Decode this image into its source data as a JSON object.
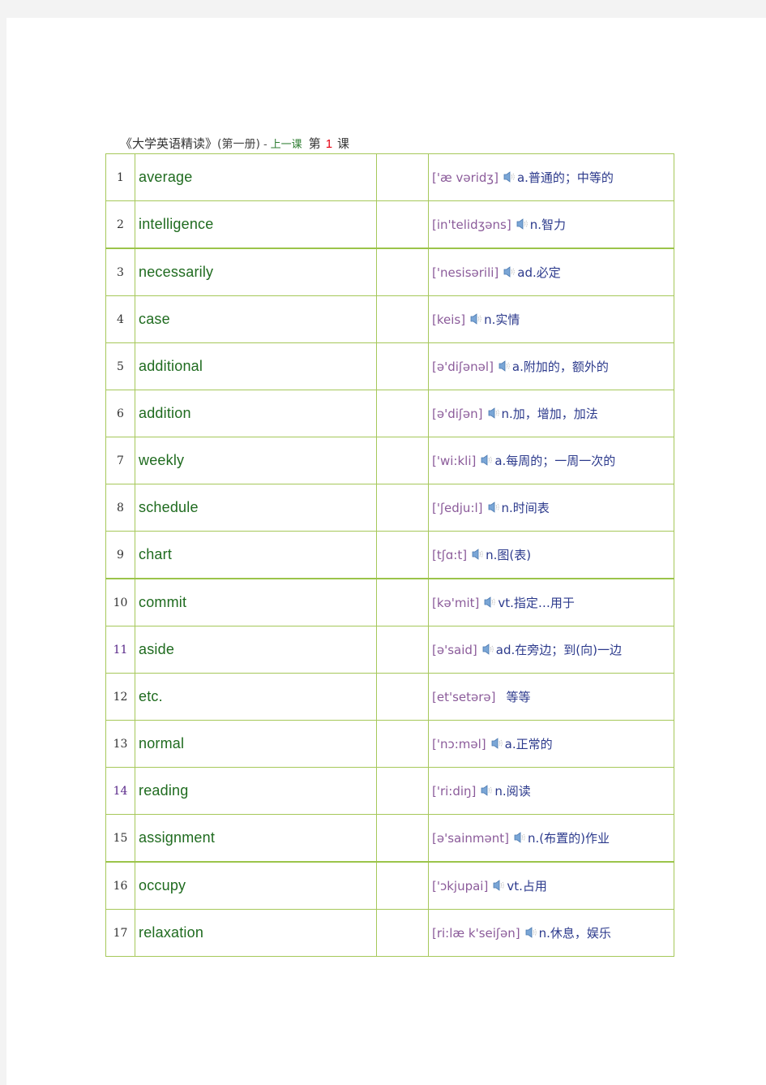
{
  "heading": {
    "book_title": "《大学英语精读》",
    "volume": "(第一册)",
    "separator": "-",
    "prev_lesson_link": "上一课",
    "lesson_prefix": "第",
    "lesson_number": "1",
    "lesson_suffix": "课"
  },
  "colors": {
    "border": "#a6c85a",
    "word": "#1f6b1f",
    "phonetic": "#8b5b9a",
    "meaning": "#2c3a8c",
    "lesson_number": "#e60012"
  },
  "vocabulary": [
    {
      "num": "1",
      "word": "average",
      "phonetic": "['æ vəridʒ]",
      "audio": true,
      "meaning": "a.普通的；中等的"
    },
    {
      "num": "2",
      "word": "intelligence",
      "phonetic": "[in'telidʒəns]",
      "audio": true,
      "meaning": "n.智力"
    },
    {
      "num": "3",
      "word": "necessarily",
      "phonetic": "['nesisərili]",
      "audio": true,
      "meaning": "ad.必定"
    },
    {
      "num": "4",
      "word": "case",
      "phonetic": "[keis]",
      "audio": true,
      "meaning": "n.实情"
    },
    {
      "num": "5",
      "word": "additional",
      "phonetic": "[ə'diʃənəl]",
      "audio": true,
      "meaning": "a.附加的，额外的"
    },
    {
      "num": "6",
      "word": "addition",
      "phonetic": "[ə'diʃən]",
      "audio": true,
      "meaning": "n.加，增加，加法"
    },
    {
      "num": "7",
      "word": "weekly",
      "phonetic": "['wi:kli]",
      "audio": true,
      "meaning": "a.每周的；一周一次的"
    },
    {
      "num": "8",
      "word": "schedule",
      "phonetic": "['ʃedju:l]",
      "audio": true,
      "meaning": "n.时间表"
    },
    {
      "num": "9",
      "word": "chart",
      "phonetic": "[tʃɑ:t]",
      "audio": true,
      "meaning": "n.图(表)"
    },
    {
      "num": "10",
      "word": "commit",
      "phonetic": "[kə'mit]",
      "audio": true,
      "meaning": "vt.指定…用于"
    },
    {
      "num": "11",
      "word": "aside",
      "phonetic": "[ə'said]",
      "audio": true,
      "meaning": "ad.在旁边；到(向)一边"
    },
    {
      "num": "12",
      "word": "etc.",
      "phonetic": "[et'setərə]",
      "audio": false,
      "meaning": "等等"
    },
    {
      "num": "13",
      "word": "normal",
      "phonetic": "['nɔ:məl]",
      "audio": true,
      "meaning": "a.正常的"
    },
    {
      "num": "14",
      "word": "reading",
      "phonetic": "['ri:diŋ]",
      "audio": true,
      "meaning": "n.阅读"
    },
    {
      "num": "15",
      "word": "assignment",
      "phonetic": "[ə'sainmənt]",
      "audio": true,
      "meaning": "n.(布置的)作业"
    },
    {
      "num": "16",
      "word": "occupy",
      "phonetic": "['ɔkjupai]",
      "audio": true,
      "meaning": "vt.占用"
    },
    {
      "num": "17",
      "word": "relaxation",
      "phonetic": "[ri:læ k'seiʃən]",
      "audio": true,
      "meaning": "n.休息，娱乐"
    }
  ]
}
